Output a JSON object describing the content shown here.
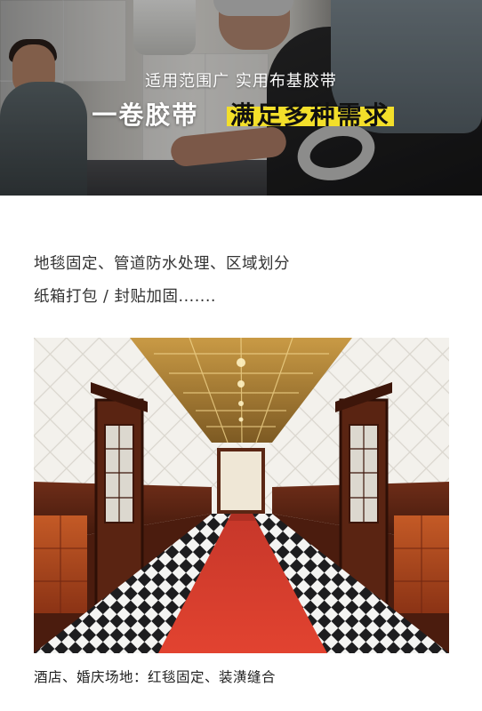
{
  "hero": {
    "subtitle": "适用范围广 实用布基胶带",
    "title_main": "一卷胶带",
    "title_highlight": "满足多种需求",
    "highlight_color": "#f3df2a"
  },
  "description": {
    "line1": "地毯固定、管道防水处理、区域划分",
    "line2": "纸箱打包 / 封贴加固......."
  },
  "photo": {
    "caption": "酒店、婚庆场地：红毯固定、装潢缝合"
  },
  "colors": {
    "text_primary": "#333333",
    "carpet_red": "#d63b2b",
    "wood": "#6b2a17",
    "ceiling_gold": "#b98b36"
  }
}
